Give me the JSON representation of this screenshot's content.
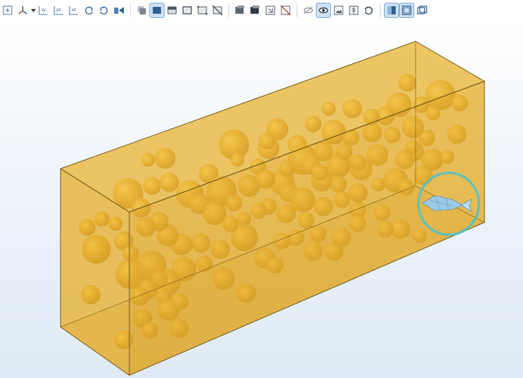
{
  "toolbar": {
    "groups": [
      [
        {
          "id": "zoom-extents",
          "icon": "zoom-extents-icon"
        },
        {
          "id": "axis-orientation",
          "icon": "axis-orientation-icon",
          "dropdown": true
        },
        {
          "id": "view-xy",
          "icon": "view-xy-icon",
          "text": "xy"
        },
        {
          "id": "view-yz",
          "icon": "view-yz-icon",
          "text": "yz"
        },
        {
          "id": "view-xz",
          "icon": "view-xz-icon",
          "text": "xz"
        },
        {
          "id": "rotate-cw",
          "icon": "rotate-clockwise-icon"
        },
        {
          "id": "rotate-ccw",
          "icon": "rotate-counterclockwise-icon"
        },
        {
          "id": "camera-view",
          "icon": "camera-view-icon"
        }
      ],
      [
        {
          "id": "select-objects",
          "icon": "select-objects-icon"
        },
        {
          "id": "select-domains",
          "icon": "select-domains-icon",
          "active": true
        },
        {
          "id": "select-boundaries",
          "icon": "select-boundaries-icon"
        },
        {
          "id": "select-edges",
          "icon": "select-edges-icon"
        },
        {
          "id": "select-points",
          "icon": "select-points-icon"
        },
        {
          "id": "clear-selection",
          "icon": "clear-selection-icon"
        }
      ],
      [
        {
          "id": "zoom-box",
          "icon": "zoom-box-icon"
        },
        {
          "id": "zoom-selected",
          "icon": "zoom-selected-icon"
        },
        {
          "id": "zoom-in-region",
          "icon": "zoom-in-region-icon"
        },
        {
          "id": "zoom-reset",
          "icon": "zoom-reset-icon"
        }
      ],
      [
        {
          "id": "hide-objects",
          "icon": "hide-eye-icon"
        },
        {
          "id": "show-view",
          "icon": "eye-view-icon",
          "active": true
        },
        {
          "id": "image-snapshot",
          "icon": "image-snapshot-icon"
        },
        {
          "id": "transparency",
          "icon": "transparency-icon"
        },
        {
          "id": "reset-view",
          "icon": "reset-view-icon"
        }
      ],
      [
        {
          "id": "wireframe-render",
          "icon": "wireframe-render-icon",
          "active": true
        },
        {
          "id": "scene-light",
          "icon": "scene-light-icon",
          "active": true
        },
        {
          "id": "render-options",
          "icon": "render-options-icon"
        }
      ]
    ]
  },
  "scene": {
    "description_colors": {
      "box_fill": "#e7b73b",
      "box_edge": "#7a5e14",
      "sphere": "#e0a522",
      "selection_ring": "#4fc3c8",
      "fish": "#a8d1ec"
    }
  }
}
